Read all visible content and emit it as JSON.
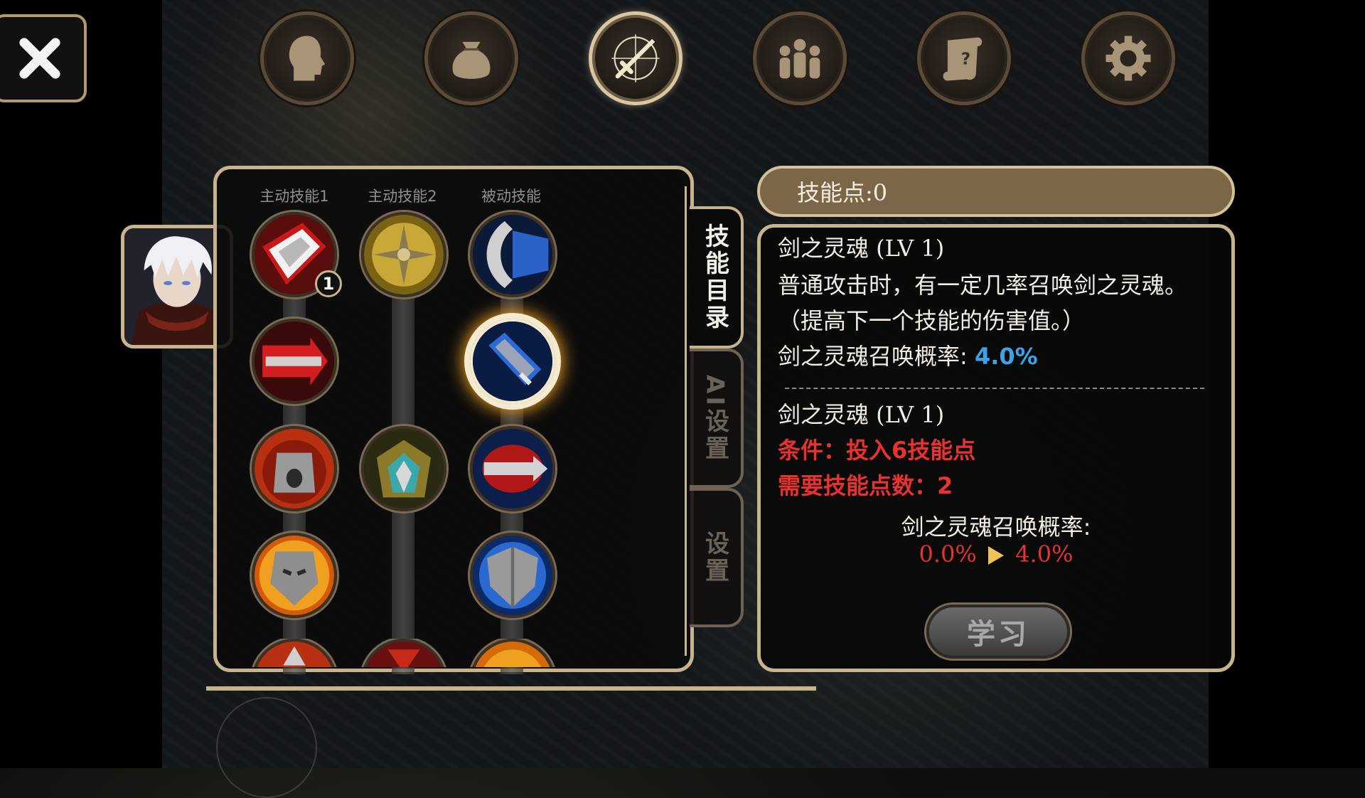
{
  "nav": {
    "close_icon": "close-x-icon",
    "tabs": [
      {
        "icon": "head-silhouette-icon",
        "active": false
      },
      {
        "icon": "bag-icon",
        "active": false
      },
      {
        "icon": "sword-compass-icon",
        "active": true
      },
      {
        "icon": "party-icon",
        "active": false
      },
      {
        "icon": "quest-scroll-icon",
        "active": false
      },
      {
        "icon": "gear-icon",
        "active": false
      }
    ]
  },
  "skill_tree": {
    "columns": [
      "主动技能1",
      "主动技能2",
      "被动技能"
    ],
    "skills": [
      {
        "name": "sword-slash",
        "column": 1,
        "row": 1,
        "level": "1"
      },
      {
        "name": "golden-burst",
        "column": 2,
        "row": 1
      },
      {
        "name": "blue-blade-passive",
        "column": 3,
        "row": 1
      },
      {
        "name": "red-thrust",
        "column": 1,
        "row": 2
      },
      {
        "name": "sword-spirit",
        "column": 3,
        "row": 2,
        "selected": true
      },
      {
        "name": "roaring-face",
        "column": 1,
        "row": 3
      },
      {
        "name": "armor-aura",
        "column": 2,
        "row": 3
      },
      {
        "name": "blood-blade",
        "column": 3,
        "row": 3
      },
      {
        "name": "fire-mask",
        "column": 1,
        "row": 4
      },
      {
        "name": "ice-shield",
        "column": 3,
        "row": 4
      }
    ]
  },
  "side_tabs": [
    {
      "label": "技能目录",
      "active": true
    },
    {
      "label": "AI设置",
      "active": false
    },
    {
      "label": "设置",
      "active": false
    }
  ],
  "points": {
    "label": "技能点:0"
  },
  "info": {
    "current_title": "剑之灵魂 (LV 1)",
    "desc_line1": "普通攻击时，有一定几率召唤剑之灵魂。",
    "desc_line2": "（提高下一个技能的伤害值。）",
    "stat_label": "剑之灵魂召唤概率:",
    "stat_value": "4.0%",
    "next_title": "剑之灵魂 (LV 1)",
    "condition": "条件：投入6技能点",
    "required_points": "需要技能点数：2",
    "upgrade_label": "剑之灵魂召唤概率:",
    "upgrade_from": "0.0%",
    "upgrade_to": "4.0%",
    "learn_button": "学习"
  },
  "colors": {
    "accent_gold": "#c8b48c",
    "value_blue": "#3aa5e6",
    "warning_red": "#e8322e"
  }
}
